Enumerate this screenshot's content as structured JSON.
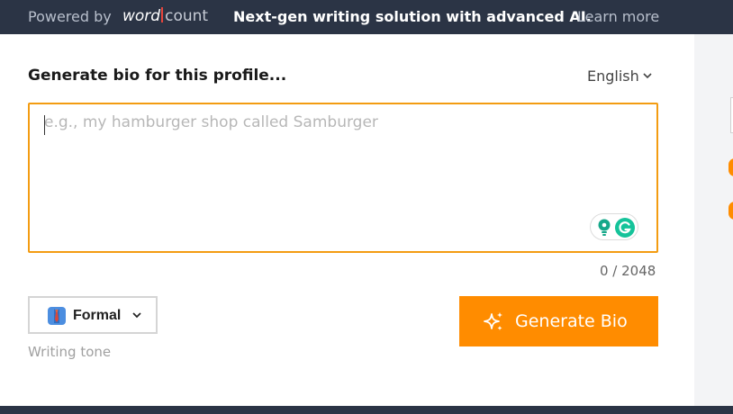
{
  "banner": {
    "powered_by": "Powered by",
    "brand_word": "word",
    "brand_count": "count",
    "promo": "Next-gen writing solution with advanced AI.",
    "learn_more": "Learn more"
  },
  "form": {
    "title": "Generate bio for this profile...",
    "language": "English",
    "input_value": "",
    "input_placeholder": "e.g., my hamburger shop called Samburger",
    "char_count": "0 / 2048",
    "tone_label": "Formal",
    "tone_caption": "Writing tone",
    "generate_label": "Generate Bio"
  },
  "icons": {
    "chevron": "chevron-down-icon",
    "tone": "necktie-icon",
    "generate": "sparkles-icon",
    "grammarly": "grammarly-icon",
    "bulb": "lightbulb-icon"
  },
  "colors": {
    "accent": "#ff8c00",
    "banner_bg": "#2b3445",
    "focus_border": "#f39c12",
    "grammarly_green": "#15c39a"
  }
}
